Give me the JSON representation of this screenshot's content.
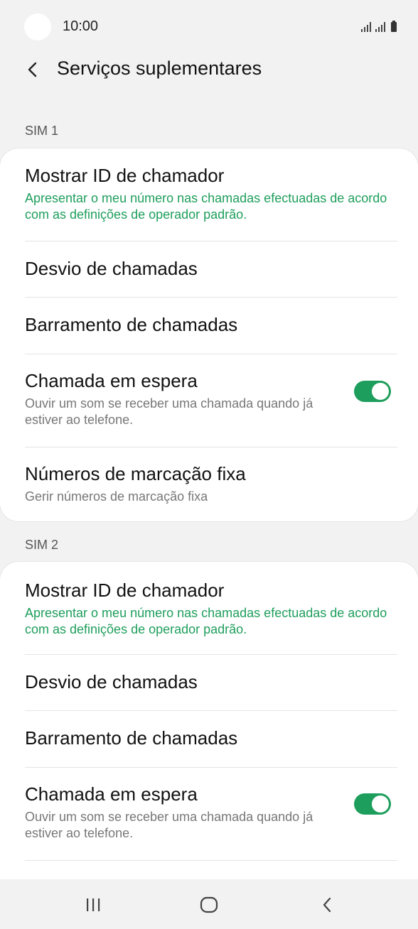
{
  "status_bar": {
    "time": "10:00"
  },
  "header": {
    "back_icon": "chevron-left-icon",
    "title": "Serviços suplementares"
  },
  "sim1": {
    "label": "SIM 1",
    "items": [
      {
        "title": "Mostrar ID de chamador",
        "subtitle": "Apresentar o meu número nas chamadas efectuadas de acordo com as definições de operador padrão."
      },
      {
        "title": "Desvio de chamadas"
      },
      {
        "title": "Barramento de chamadas"
      },
      {
        "title": "Chamada em espera",
        "subtitle": "Ouvir um som se receber uma chamada quando já estiver ao telefone.",
        "toggle": "on"
      },
      {
        "title": "Números de marcação fixa",
        "subtitle": "Gerir números de marcação fixa"
      }
    ]
  },
  "sim2": {
    "label": "SIM 2",
    "items": [
      {
        "title": "Mostrar ID de chamador",
        "subtitle": "Apresentar o meu número nas chamadas efectuadas de acordo com as definições de operador padrão."
      },
      {
        "title": "Desvio de chamadas"
      },
      {
        "title": "Barramento de chamadas"
      },
      {
        "title": "Chamada em espera",
        "subtitle": "Ouvir um som se receber uma chamada quando já estiver ao telefone.",
        "toggle": "on"
      }
    ]
  },
  "nav": {
    "recents_icon": "recents-icon",
    "home_icon": "home-icon",
    "back_icon": "back-icon"
  },
  "colors": {
    "accent": "#1e9e5c",
    "background": "#f2f2f2",
    "card": "#ffffff"
  }
}
